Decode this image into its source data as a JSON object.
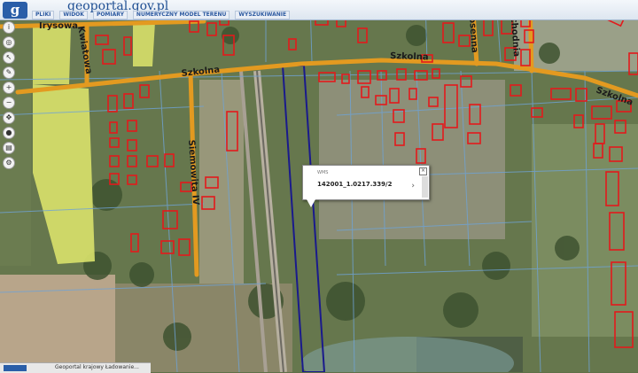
{
  "app": {
    "logo_text": "g",
    "brand": "geoportal.gov.pl",
    "menu": [
      "PLIKI",
      "WIDOK",
      "POMIARY",
      "NUMERYCZNY MODEL TERENU",
      "WYSZUKIWANIE"
    ]
  },
  "streets": {
    "szkolna_1": "Szkolna",
    "szkolna_2": "Szkolna",
    "szkolna_3": "Szkolna",
    "irysowa": "Irysowa",
    "kwiatowa": "Kwiatowa",
    "siemowita": "Siemowita IV",
    "wiosenna": "Wiosenna",
    "zachodnia": "Zachodnia"
  },
  "popup": {
    "label": "WMS",
    "parcel_id": "142001_1.0217.339/2",
    "close": "×",
    "next": "›"
  },
  "status": {
    "text": "Geoportal krajowy  Ładowanie..."
  },
  "colors": {
    "road": "#e39a20",
    "building_outline": "#e31a1c",
    "parcel_line": "#6fa3d6",
    "selected_parcel": "#1a1a8c",
    "field": "#d8e06a"
  }
}
